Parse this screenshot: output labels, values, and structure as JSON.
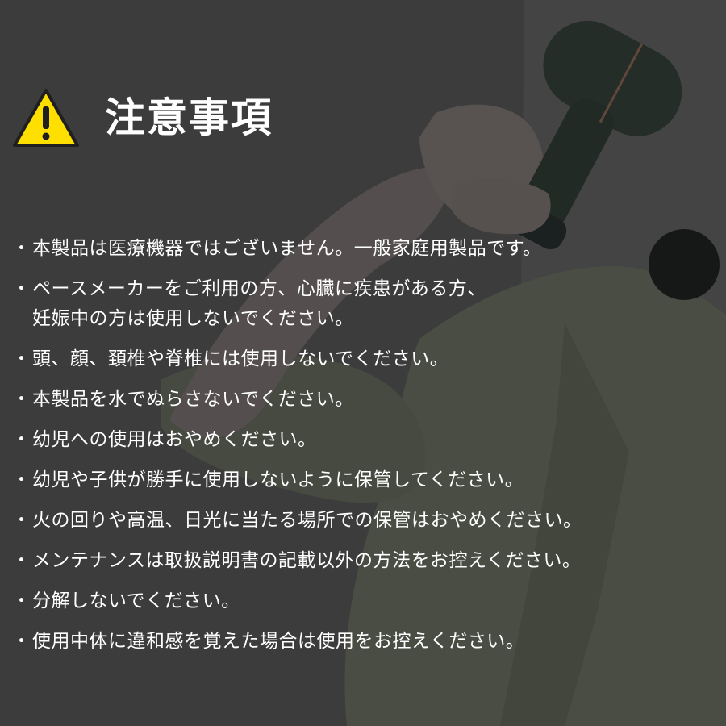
{
  "heading": {
    "title": "注意事項",
    "icon": "warning-icon"
  },
  "colors": {
    "background": "#4b4b4b",
    "warning_yellow": "#ffdf00",
    "text": "#ffffff"
  },
  "notes": [
    {
      "bullet": "・",
      "lines": [
        "本製品は医療機器ではございません。一般家庭用製品です。"
      ]
    },
    {
      "bullet": "・",
      "lines": [
        "ペースメーカーをご利用の方、心臓に疾患がある方、",
        "妊娠中の方は使用しないでください。"
      ]
    },
    {
      "bullet": "・",
      "lines": [
        "頭、顔、頚椎や脊椎には使用しないでください。"
      ]
    },
    {
      "bullet": "・",
      "lines": [
        "本製品を水でぬらさないでください。"
      ]
    },
    {
      "bullet": "・",
      "lines": [
        "幼児への使用はおやめください。"
      ]
    },
    {
      "bullet": "・",
      "lines": [
        "幼児や子供が勝手に使用しないように保管してください。"
      ]
    },
    {
      "bullet": "・",
      "lines": [
        "火の回りや高温、日光に当たる場所での保管はおやめください。"
      ]
    },
    {
      "bullet": "・",
      "lines": [
        "メンテナンスは取扱説明書の記載以外の方法をお控えください。"
      ]
    },
    {
      "bullet": "・",
      "lines": [
        "分解しないでください。"
      ]
    },
    {
      "bullet": "・",
      "lines": [
        "使用中体に違和感を覚えた場合は使用をお控えください。"
      ]
    }
  ]
}
